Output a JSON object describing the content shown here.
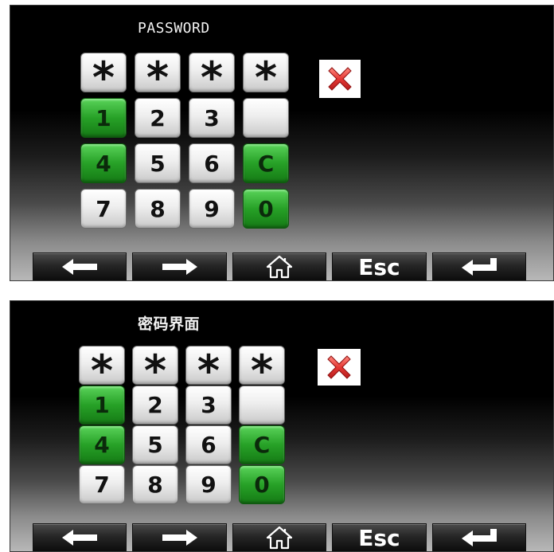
{
  "panels": [
    {
      "title": "PASSWORD",
      "mask_keys": [
        "*",
        "*",
        "*",
        "*"
      ],
      "keys": [
        {
          "label": "1",
          "style": "green"
        },
        {
          "label": "2",
          "style": "grey"
        },
        {
          "label": "3",
          "style": "grey"
        },
        {
          "label": "",
          "style": "grey"
        },
        {
          "label": "4",
          "style": "green"
        },
        {
          "label": "5",
          "style": "grey"
        },
        {
          "label": "6",
          "style": "grey"
        },
        {
          "label": "C",
          "style": "green"
        },
        {
          "label": "7",
          "style": "grey"
        },
        {
          "label": "8",
          "style": "grey"
        },
        {
          "label": "9",
          "style": "grey"
        },
        {
          "label": "0",
          "style": "green"
        }
      ],
      "toolbar": [
        {
          "icon": "arrow-left-icon"
        },
        {
          "icon": "arrow-right-icon"
        },
        {
          "icon": "home-icon"
        },
        {
          "label": "Esc"
        },
        {
          "icon": "enter-icon"
        }
      ]
    },
    {
      "title": "密码界面",
      "mask_keys": [
        "*",
        "*",
        "*",
        "*"
      ],
      "keys": [
        {
          "label": "1",
          "style": "green"
        },
        {
          "label": "2",
          "style": "grey"
        },
        {
          "label": "3",
          "style": "grey"
        },
        {
          "label": "",
          "style": "grey"
        },
        {
          "label": "4",
          "style": "green"
        },
        {
          "label": "5",
          "style": "grey"
        },
        {
          "label": "6",
          "style": "grey"
        },
        {
          "label": "C",
          "style": "green"
        },
        {
          "label": "7",
          "style": "grey"
        },
        {
          "label": "8",
          "style": "grey"
        },
        {
          "label": "9",
          "style": "grey"
        },
        {
          "label": "0",
          "style": "green"
        }
      ],
      "toolbar": [
        {
          "icon": "arrow-left-icon"
        },
        {
          "icon": "arrow-right-icon"
        },
        {
          "icon": "home-icon"
        },
        {
          "label": "Esc"
        },
        {
          "icon": "enter-icon"
        }
      ]
    }
  ],
  "colors": {
    "key_green": "#27a127",
    "close_red": "#e53935",
    "background": "#000000"
  }
}
